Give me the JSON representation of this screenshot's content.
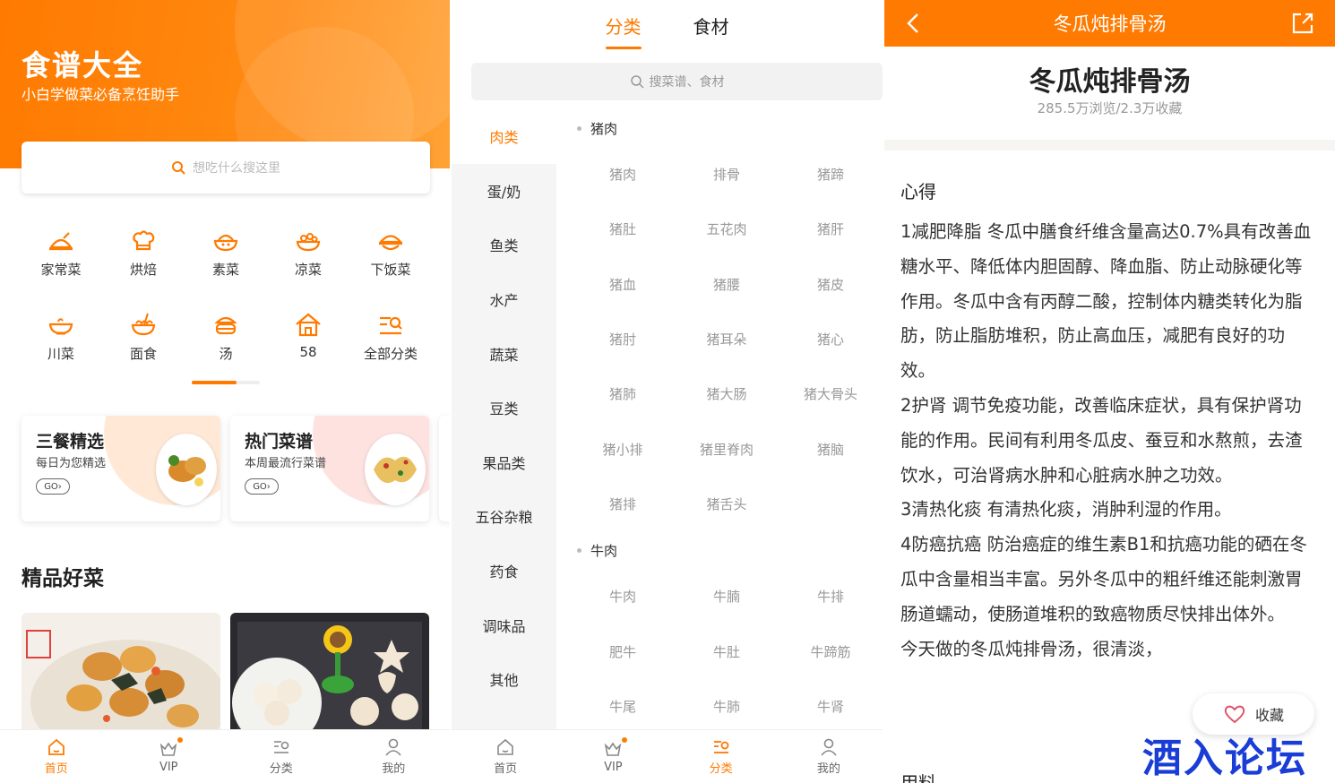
{
  "colors": {
    "accent": "#ff7a00",
    "accent_light": "#ffa235",
    "watermark": "#1a3dd6"
  },
  "home": {
    "title": "食谱大全",
    "subtitle": "小白学做菜必备烹饪助手",
    "search_placeholder": "想吃什么搜这里",
    "categories": [
      {
        "label": "家常菜",
        "icon": "home-cooking-icon"
      },
      {
        "label": "烘焙",
        "icon": "chef-hat-icon"
      },
      {
        "label": "素菜",
        "icon": "veggie-bowl-icon"
      },
      {
        "label": "凉菜",
        "icon": "cold-dish-icon"
      },
      {
        "label": "下饭菜",
        "icon": "rice-dish-icon"
      },
      {
        "label": "川菜",
        "icon": "sichuan-bowl-icon"
      },
      {
        "label": "面食",
        "icon": "noodle-icon"
      },
      {
        "label": "汤",
        "icon": "soup-pot-icon"
      },
      {
        "label": "58",
        "icon": "house-icon"
      },
      {
        "label": "全部分类",
        "icon": "all-categories-icon"
      }
    ],
    "promos": [
      {
        "title": "三餐精选",
        "subtitle": "每日为您精选",
        "go": "GO›"
      },
      {
        "title": "热门菜谱",
        "subtitle": "本周最流行菜谱",
        "go": "GO›"
      }
    ],
    "section_title": "精品好菜"
  },
  "tabbar": {
    "items": [
      {
        "label": "首页",
        "icon": "home-icon"
      },
      {
        "label": "VIP",
        "icon": "vip-crown-icon"
      },
      {
        "label": "分类",
        "icon": "category-list-icon"
      },
      {
        "label": "我的",
        "icon": "profile-icon"
      }
    ]
  },
  "category": {
    "tabs": [
      "分类",
      "食材"
    ],
    "search_placeholder": "搜菜谱、食材",
    "sidebar": [
      "肉类",
      "蛋/奶",
      "鱼类",
      "水产",
      "蔬菜",
      "豆类",
      "果品类",
      "五谷杂粮",
      "药食",
      "调味品",
      "其他"
    ],
    "groups": [
      {
        "name": "猪肉",
        "items": [
          "猪肉",
          "排骨",
          "猪蹄",
          "猪肚",
          "五花肉",
          "猪肝",
          "猪血",
          "猪腰",
          "猪皮",
          "猪肘",
          "猪耳朵",
          "猪心",
          "猪肺",
          "猪大肠",
          "猪大骨头",
          "猪小排",
          "猪里脊肉",
          "猪脑",
          "猪排",
          "猪舌头"
        ]
      },
      {
        "name": "牛肉",
        "items": [
          "牛肉",
          "牛腩",
          "牛排",
          "肥牛",
          "牛肚",
          "牛蹄筋",
          "牛尾",
          "牛肺",
          "牛肾"
        ]
      }
    ]
  },
  "recipe": {
    "header_title": "冬瓜炖排骨汤",
    "title": "冬瓜炖排骨汤",
    "stats": "285.5万浏览/2.3万收藏",
    "tips_heading": "心得",
    "tips": [
      "1减肥降脂 冬瓜中膳食纤维含量高达0.7%具有改善血糖水平、降低体内胆固醇、降血脂、防止动脉硬化等作用。冬瓜中含有丙醇二酸，控制体内糖类转化为脂肪，防止脂肪堆积，防止高血压，减肥有良好的功效。",
      "2护肾 调节免疫功能，改善临床症状，具有保护肾功能的作用。民间有利用冬瓜皮、蚕豆和水熬煎，去渣饮水，可治肾病水肿和心脏病水肿之功效。",
      "3清热化痰 有清热化痰，消肿利湿的作用。",
      "4防癌抗癌 防治癌症的维生素B1和抗癌功能的硒在冬瓜中含量相当丰富。另外冬瓜中的粗纤维还能刺激胃肠道蠕动，使肠道堆积的致癌物质尽快排出体外。",
      "今天做的冬瓜炖排骨汤，很清淡，"
    ],
    "favorite_label": "收藏",
    "ingredients_heading": "用料"
  },
  "watermark": "酒入论坛"
}
